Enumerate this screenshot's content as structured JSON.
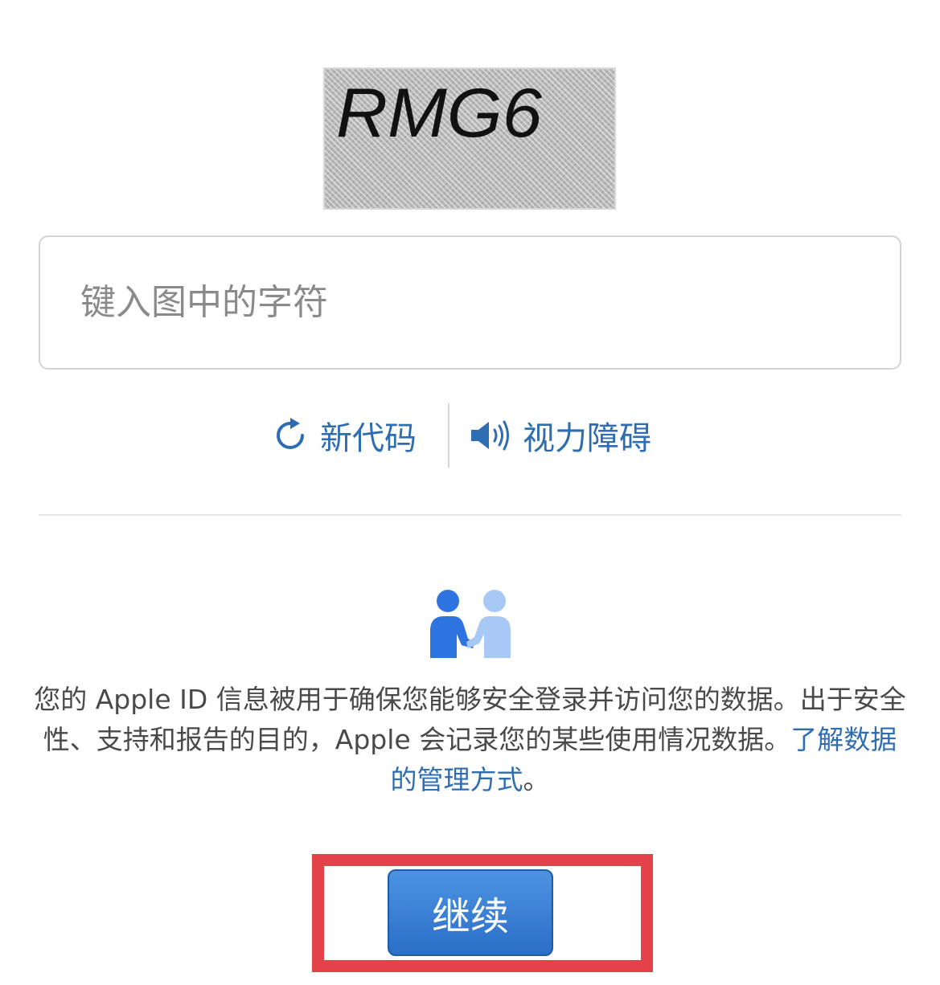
{
  "captcha": {
    "text": "RMG6"
  },
  "input": {
    "placeholder": "键入图中的字符",
    "value": ""
  },
  "links": {
    "new_code": "新代码",
    "accessibility": "视力障碍"
  },
  "privacy": {
    "text": "您的 Apple ID 信息被用于确保您能够安全登录并访问您的数据。出于安全性、支持和报告的目的，Apple 会记录您的某些使用情况数据。",
    "link": "了解数据的管理方式",
    "end": "。"
  },
  "continue_label": "继续",
  "colors": {
    "accent": "#2f6db3",
    "button": "#3a7fd5",
    "highlight": "#e5414a"
  }
}
